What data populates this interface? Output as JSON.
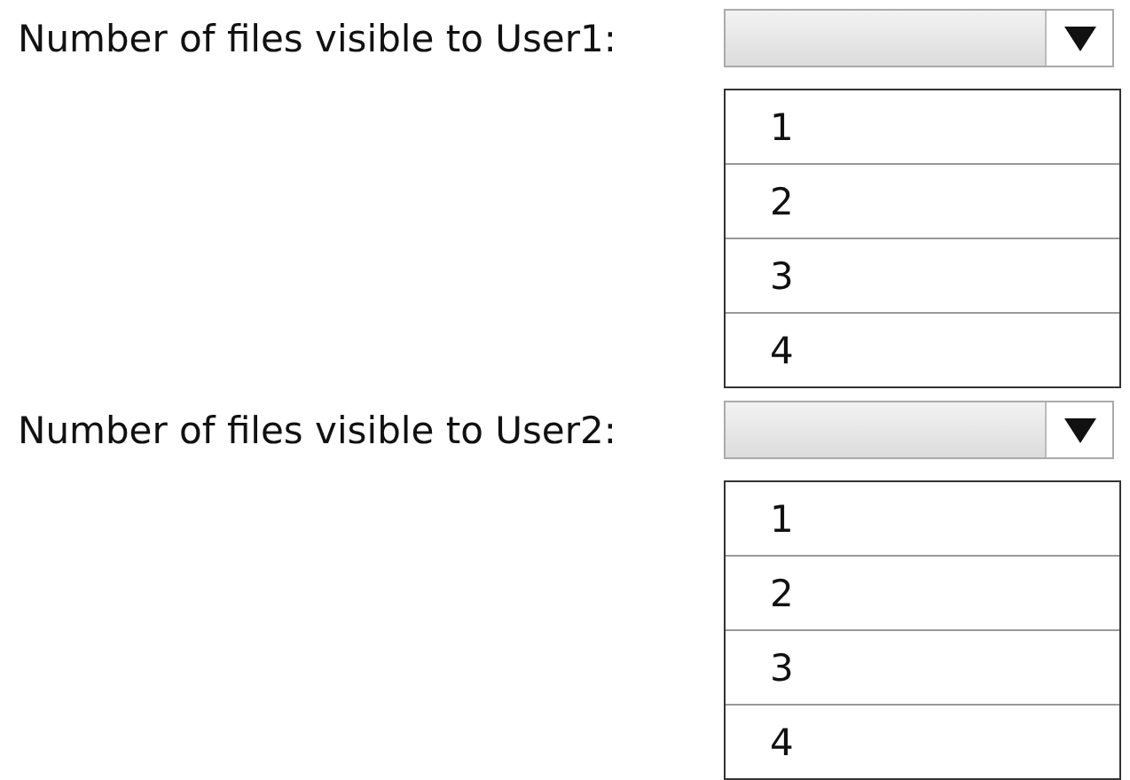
{
  "questions": [
    {
      "label": "Number of files visible to User1:",
      "options": [
        {
          "label": "1"
        },
        {
          "label": "2"
        },
        {
          "label": "3"
        },
        {
          "label": "4"
        }
      ]
    },
    {
      "label": "Number of files visible to User2:",
      "options": [
        {
          "label": "1"
        },
        {
          "label": "2"
        },
        {
          "label": "3"
        },
        {
          "label": "4"
        }
      ]
    }
  ]
}
